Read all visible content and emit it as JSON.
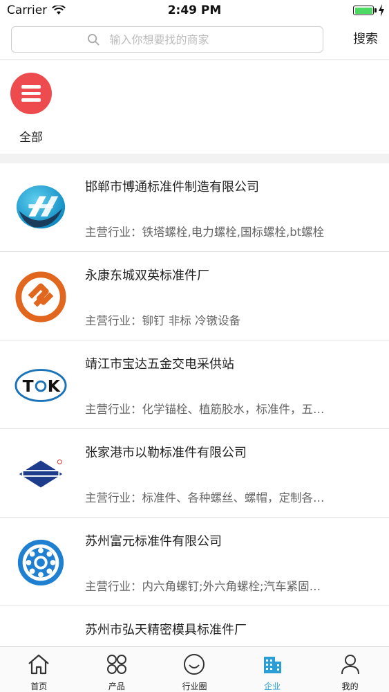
{
  "status": {
    "carrier": "Carrier",
    "time": "2:49 PM"
  },
  "search": {
    "placeholder": "输入你想要找的商家",
    "button_label": "搜索"
  },
  "category": {
    "label": "全部"
  },
  "companies": [
    {
      "name": "邯郸市博通标准件制造有限公司",
      "industry": "主营行业：铁塔螺栓,电力螺栓,国标螺栓,bt螺栓",
      "logo": "botong-logo"
    },
    {
      "name": "永康东城双英标准件厂",
      "industry": "主营行业：铆钉 非标 冷镦设备",
      "logo": "shuangying-logo"
    },
    {
      "name": "靖江市宝达五金交电采供站",
      "industry": "主营行业：化学锚栓、植筋胶水，标准件，五…",
      "logo": "tok-logo"
    },
    {
      "name": "张家港市以勒标准件有限公司",
      "industry": "主营行业：标准件、各种螺丝、螺帽，定制各…",
      "logo": "pht-logo"
    },
    {
      "name": "苏州富元标准件有限公司",
      "industry": "主营行业：内六角螺钉;外六角螺栓;汽车紧固…",
      "logo": "fuyuan-logo"
    },
    {
      "name": "苏州市弘天精密模具标准件厂",
      "industry": "",
      "logo": "hongtian-logo"
    }
  ],
  "tabs": [
    {
      "label": "首页",
      "icon": "home-icon"
    },
    {
      "label": "产品",
      "icon": "grid-icon"
    },
    {
      "label": "行业圈",
      "icon": "smile-icon"
    },
    {
      "label": "企业",
      "icon": "building-icon"
    },
    {
      "label": "我的",
      "icon": "user-icon"
    }
  ],
  "colors": {
    "accent": "#2a9fd6",
    "category_red": "#ee4b4f",
    "battery": "#4cd964"
  }
}
